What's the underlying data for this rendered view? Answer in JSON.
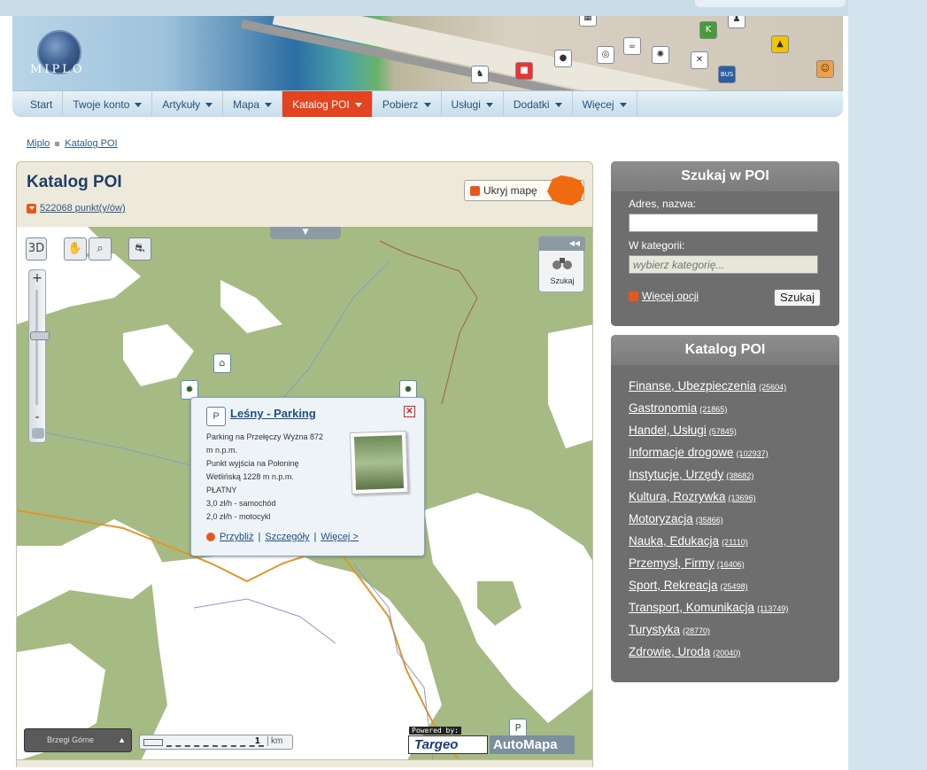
{
  "logo": {
    "text": "MIPLO"
  },
  "nav": [
    {
      "label": "Start",
      "dropdown": false,
      "active": false
    },
    {
      "label": "Twoje konto",
      "dropdown": true,
      "active": false
    },
    {
      "label": "Artykuły",
      "dropdown": true,
      "active": false
    },
    {
      "label": "Mapa",
      "dropdown": true,
      "active": false
    },
    {
      "label": "Katalog POI",
      "dropdown": true,
      "active": true
    },
    {
      "label": "Pobierz",
      "dropdown": true,
      "active": false
    },
    {
      "label": "Usługi",
      "dropdown": true,
      "active": false
    },
    {
      "label": "Dodatki",
      "dropdown": true,
      "active": false
    },
    {
      "label": "Więcej",
      "dropdown": true,
      "active": false
    }
  ],
  "breadcrumb": [
    "Miplo",
    "Katalog POI"
  ],
  "main": {
    "title": "Katalog POI",
    "count_link": "522068 punkt(y/ów)",
    "hide_map_button": "Ukryj mapę"
  },
  "map": {
    "search_tab_label": "Szukaj",
    "zoom_plus": "+",
    "zoom_minus": "-",
    "location_select": "Brzegi Górne",
    "scale_value": "1",
    "scale_unit": "km",
    "powered_by": "Powered by:",
    "brand_targeo": "Targeo",
    "brand_automapa": "AutoMapa",
    "popup": {
      "title": "Leśny - Parking",
      "description": [
        "Parking na Przełęczy Wyżna 872",
        "m n.p.m.",
        "Punkt wyjścia na Połoninę",
        "Wetlińską 1228 m n.p.m.",
        "PŁATNY",
        "3,0 zł/h - samochód",
        "2,0 zł/h - motocykl"
      ],
      "links": [
        "Przybliż",
        "Szczegóły",
        "Więcej >"
      ]
    }
  },
  "search_panel": {
    "title": "Szukaj w POI",
    "address_label": "Adres, nazwa:",
    "address_value": "",
    "category_label": "W kategorii:",
    "category_placeholder": "wybierz kategorię...",
    "more_options": "Więcej opcji",
    "search_button": "Szukaj"
  },
  "catalog_panel": {
    "title": "Katalog POI",
    "categories": [
      {
        "name": "Finanse, Ubezpieczenia",
        "count": "(25604)"
      },
      {
        "name": "Gastronomia",
        "count": "(21865)"
      },
      {
        "name": "Handel, Usługi",
        "count": "(57845)"
      },
      {
        "name": "Informacje drogowe",
        "count": "(102937)"
      },
      {
        "name": "Instytucje, Urzędy",
        "count": "(38682)"
      },
      {
        "name": "Kultura, Rozrywka",
        "count": "(13696)"
      },
      {
        "name": "Motoryzacja",
        "count": "(35866)"
      },
      {
        "name": "Nauka, Edukacja",
        "count": "(21110)"
      },
      {
        "name": "Przemysł, Firmy",
        "count": "(16406)"
      },
      {
        "name": "Sport, Rekreacja",
        "count": "(25498)"
      },
      {
        "name": "Transport, Komunikacja",
        "count": "(113749)"
      },
      {
        "name": "Turystyka",
        "count": "(28770)"
      },
      {
        "name": "Zdrowie, Uroda",
        "count": "(20040)"
      }
    ]
  },
  "colors": {
    "accent": "#e3431f",
    "link": "#2d5a8a",
    "panel": "#6e6e6e",
    "map_green": "#a6ba84"
  }
}
